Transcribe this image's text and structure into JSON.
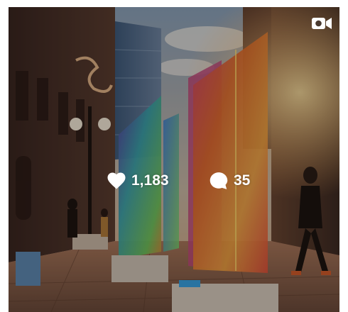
{
  "post": {
    "type_icon": "video-camera-icon",
    "likes": {
      "icon": "heart-icon",
      "count": "1,183"
    },
    "comments": {
      "icon": "comment-bubble-icon",
      "count": "35"
    }
  },
  "colors": {
    "overlay_text": "#ffffff"
  }
}
